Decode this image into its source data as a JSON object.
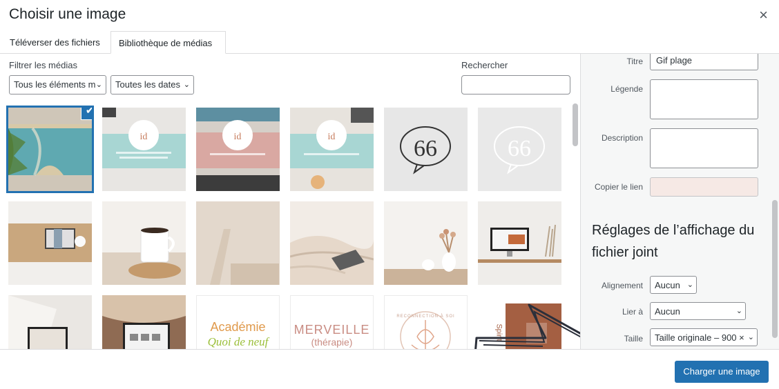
{
  "modal": {
    "title": "Choisir une image",
    "close_label": "×"
  },
  "tabs": [
    {
      "label": "Téléverser des fichiers"
    },
    {
      "label": "Bibliothèque de médias"
    }
  ],
  "filters": {
    "label": "Filtrer les médias",
    "type_select": "Tous les éléments m",
    "date_select": "Toutes les dates",
    "search_label": "Rechercher",
    "search_value": ""
  },
  "media": [
    {
      "name": "beach",
      "selected": true
    },
    {
      "name": "teal-card-1"
    },
    {
      "name": "pink-card"
    },
    {
      "name": "teal-card-2"
    },
    {
      "name": "quote-gray"
    },
    {
      "name": "quote-light"
    },
    {
      "name": "laptop-desk-banner"
    },
    {
      "name": "coffee-cup"
    },
    {
      "name": "beige-chair"
    },
    {
      "name": "bed-laptop"
    },
    {
      "name": "vase-flowers"
    },
    {
      "name": "desk-monitor"
    },
    {
      "name": "laptop-bed-2"
    },
    {
      "name": "laptop-blanket"
    },
    {
      "name": "academie-logo",
      "line1": "Académie",
      "line2": "Quoi de neuf"
    },
    {
      "name": "merveille-logo",
      "line1": "MERVEILLE",
      "line2": "(thérapie)"
    },
    {
      "name": "reconnection-logo",
      "line1": "RECONNECTION À SOI"
    },
    {
      "name": "brown-spirit",
      "line1": "Spirit"
    }
  ],
  "details": {
    "title_label": "Titre",
    "title_value": "Gif plage",
    "caption_label": "Légende",
    "caption_value": "",
    "description_label": "Description",
    "description_value": "",
    "copy_link_label": "Copier le lien",
    "copy_link_value": ""
  },
  "display_settings": {
    "heading": "Réglages de l’affichage du fichier joint",
    "alignment_label": "Alignement",
    "alignment_value": "Aucun",
    "link_label": "Lier à",
    "link_value": "Aucun",
    "size_label": "Taille",
    "size_value": "Taille originale – 900 ×"
  },
  "footer": {
    "primary_label": "Charger une image"
  },
  "colors": {
    "accent": "#2271b1",
    "copy_field_bg": "#f6e9e5"
  }
}
